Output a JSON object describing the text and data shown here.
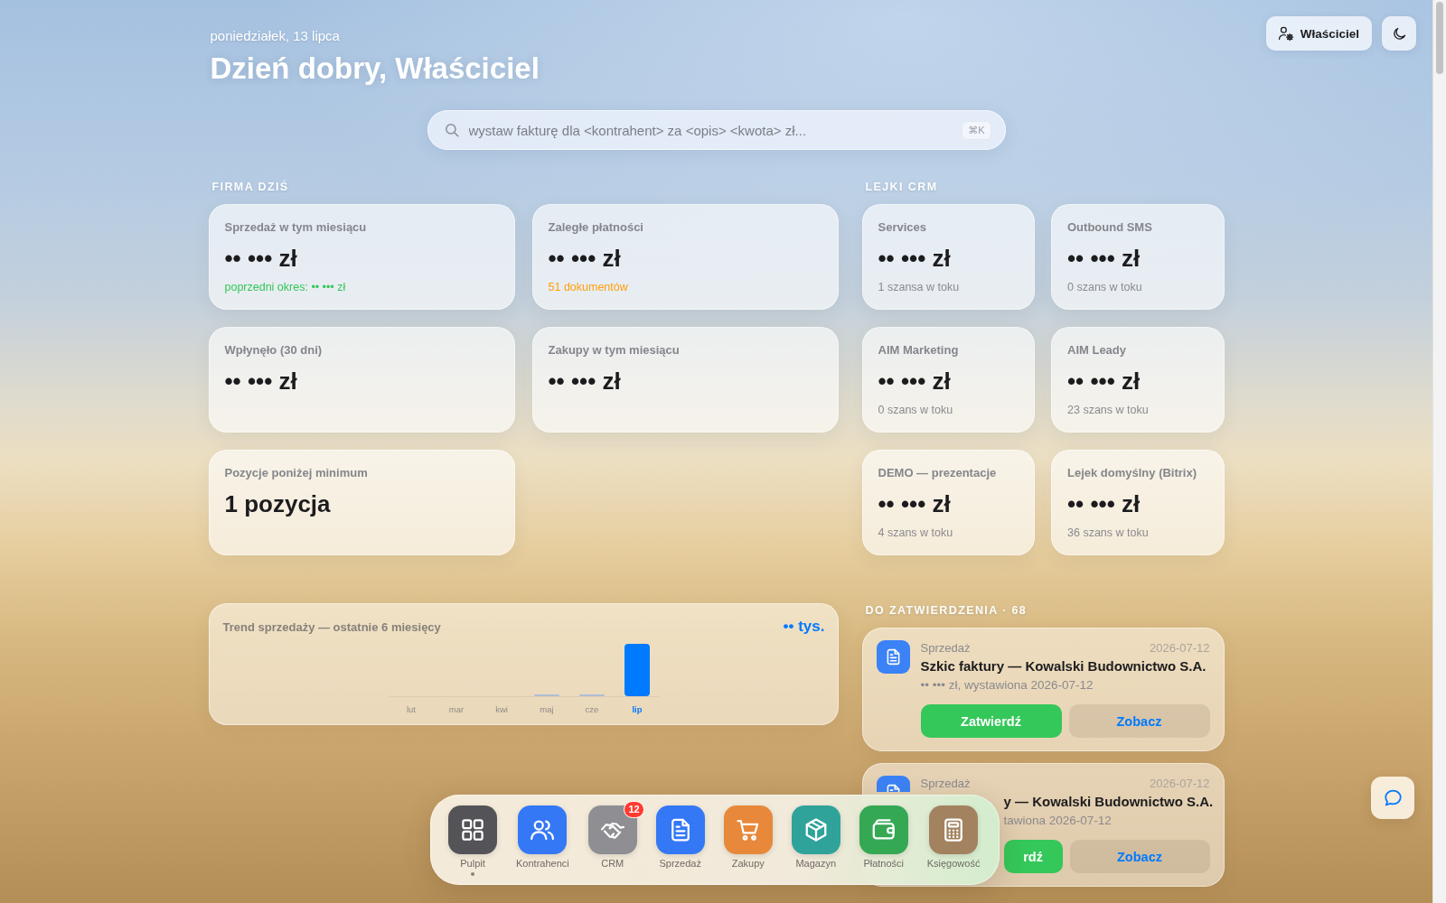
{
  "header": {
    "date": "poniedziałek, 13 lipca",
    "greeting": "Dzień dobry, Właściciel"
  },
  "account": {
    "label": "Właściciel"
  },
  "search": {
    "placeholder": "wystaw fakturę dla <kontrahent> za <opis> <kwota> zł...",
    "shortcut": "⌘K"
  },
  "company_today": {
    "title": "FIRMA DZIŚ",
    "cards": [
      {
        "label": "Sprzedaż w tym miesiącu",
        "value": "•• ••• zł",
        "note": "poprzedni okres: •• ••• zł",
        "color": "#34c759"
      },
      {
        "label": "Zaległe płatności",
        "value": "•• ••• zł",
        "note": "51 dokumentów",
        "color": "#ff9f0a"
      },
      {
        "label": "Wpłynęło (30 dni)",
        "value": "•• ••• zł"
      },
      {
        "label": "Zakupy w tym miesiącu",
        "value": "•• ••• zł"
      },
      {
        "label": "Pozycje poniżej minimum",
        "value": "1 pozycja"
      }
    ]
  },
  "crm_funnels": {
    "title": "LEJKI CRM",
    "cards": [
      {
        "name": "Services",
        "value": "•• ••• zł",
        "note": "1 szansa w toku"
      },
      {
        "name": "Outbound SMS",
        "value": "•• ••• zł",
        "note": "0 szans w toku"
      },
      {
        "name": "AIM Marketing",
        "value": "•• ••• zł",
        "note": "0 szans w toku"
      },
      {
        "name": "AIM Leady",
        "value": "•• ••• zł",
        "note": "23 szans w toku"
      },
      {
        "name": "DEMO — prezentacje",
        "value": "•• ••• zł",
        "note": "4 szans w toku"
      },
      {
        "name": "Lejek domyślny (Bitrix)",
        "value": "•• ••• zł",
        "note": "36 szans w toku"
      }
    ]
  },
  "sales_trend": {
    "title": "Trend sprzedaży — ostatnie 6 miesięcy",
    "total": "•• tys.",
    "months": [
      {
        "label": "lut",
        "selected": false
      },
      {
        "label": "mar",
        "selected": false
      },
      {
        "label": "kwi",
        "selected": false
      },
      {
        "label": "maj",
        "selected": false
      },
      {
        "label": "cze",
        "selected": false
      },
      {
        "label": "lip",
        "selected": true
      }
    ]
  },
  "approvals": {
    "title": "DO ZATWIERDZENIA · 68",
    "items": [
      {
        "kind": "full",
        "category": "Sprzedaż",
        "date": "2026-07-12",
        "title": "Szkic faktury — Kowalski Budownictwo S.A.",
        "detail": "•• ••• zł, wystawiona 2026-07-12",
        "approve": "Zatwierdź",
        "view": "Zobacz"
      },
      {
        "kind": "covered",
        "category": "Sprzedaż",
        "date": "2026-07-12",
        "title": "y — Kowalski Budownictwo S.A.",
        "detail": "tawiona 2026-07-12",
        "approve": "rdź",
        "view": "Zobacz"
      }
    ]
  },
  "dock": {
    "items": [
      {
        "kind": "dashboard",
        "label": "Pulpit",
        "color": "#545458",
        "selected": true
      },
      {
        "kind": "contacts",
        "label": "Kontrahenci",
        "color": "#3478f6",
        "selected": false
      },
      {
        "kind": "crm",
        "label": "CRM",
        "color": "#8e8e93",
        "selected": false,
        "badge": "12"
      },
      {
        "kind": "sales",
        "label": "Sprzedaż",
        "color": "#3478f6",
        "selected": false
      },
      {
        "kind": "purchases",
        "label": "Zakupy",
        "color": "#e8883a",
        "selected": false
      },
      {
        "kind": "warehouse",
        "label": "Magazyn",
        "color": "#2fa39a",
        "selected": false
      },
      {
        "kind": "payments",
        "label": "Płatności",
        "color": "#34a853",
        "selected": false
      },
      {
        "kind": "accounting",
        "label": "Księgowość",
        "color": "#a2825f",
        "selected": false
      }
    ]
  }
}
